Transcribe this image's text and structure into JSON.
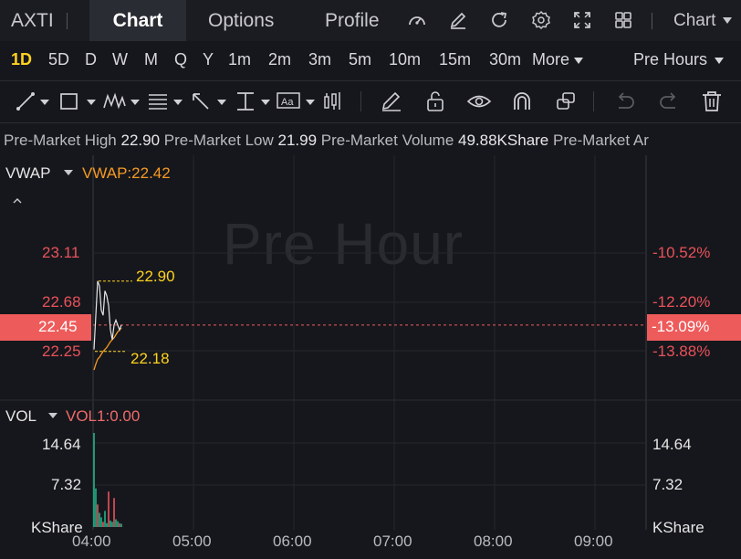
{
  "ticker": "AXTI",
  "tabs": [
    {
      "label": "Chart",
      "active": true
    },
    {
      "label": "Options"
    },
    {
      "label": "Profile"
    }
  ],
  "chart_menu_label": "Chart",
  "intervals": [
    "1D",
    "5D",
    "D",
    "W",
    "M",
    "Q",
    "Y",
    "1m",
    "2m",
    "3m",
    "5m",
    "10m",
    "15m",
    "30m"
  ],
  "more_label": "More",
  "session_label": "Pre Hours",
  "info": {
    "high_label": "Pre-Market High",
    "high_value": "22.90",
    "low_label": "Pre-Market Low",
    "low_value": "21.99",
    "volume_label": "Pre-Market Volume",
    "volume_value": "49.88KShare",
    "trailing_label": "Pre-Market Ar"
  },
  "watermark": "Pre Hour",
  "vwap": {
    "indicator_label": "VWAP",
    "indicator_value": "VWAP:22.42",
    "price_ticks": [
      "23.11",
      "22.68",
      "22.45",
      "22.25"
    ],
    "pct_ticks": [
      "-10.52%",
      "-12.20%",
      "-13.09%",
      "-13.88%"
    ],
    "high_marker": "22.90",
    "low_marker": "22.18"
  },
  "vol": {
    "indicator_label": "VOL",
    "indicator_value": "VOL1:0.00",
    "left_ticks": [
      "14.64",
      "7.32",
      "KShare"
    ],
    "right_ticks": [
      "14.64",
      "7.32",
      "KShare"
    ]
  },
  "time_axis": [
    "04:00",
    "05:00",
    "06:00",
    "07:00",
    "08:00",
    "09:00"
  ],
  "chart_data": {
    "type": "line",
    "series": [
      {
        "name": "VWAP",
        "values": [
          21.99,
          22.05,
          22.1,
          22.12,
          22.15,
          22.18,
          22.2,
          22.22,
          22.25,
          22.28,
          22.3,
          22.32,
          22.35,
          22.38,
          22.4,
          22.42
        ]
      },
      {
        "values": [
          22.2,
          22.55,
          22.9,
          22.85,
          22.6,
          22.55,
          22.8,
          22.75,
          22.65,
          22.4,
          22.3,
          22.45,
          22.5,
          22.45,
          22.4,
          22.45
        ]
      }
    ],
    "volume": [
      14.6,
      6.0,
      3.5,
      2.2,
      1.5,
      0.8,
      2.5,
      0.6,
      5.5,
      1.0,
      0.8,
      4.5,
      1.2,
      0.9,
      0.6,
      0.5
    ],
    "ylim": [
      21.99,
      23.3
    ],
    "vol_ylim": [
      0,
      18
    ],
    "colors": {
      "price": "#e6e6e6",
      "vwap": "#f59a23",
      "up": "#1fb38a",
      "down": "#e8525a"
    }
  }
}
